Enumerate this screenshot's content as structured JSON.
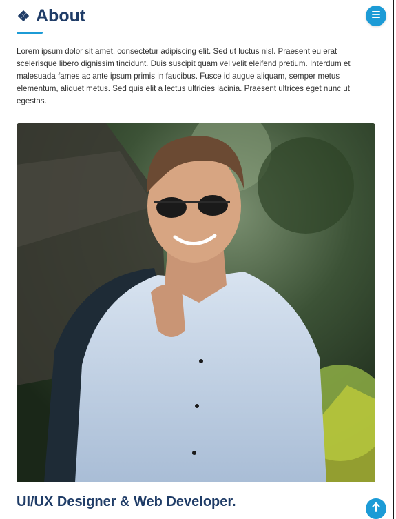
{
  "header": {
    "title": "About",
    "title_icon": "diamond-icon",
    "menu_icon": "menu-icon"
  },
  "about": {
    "text": "Lorem ipsum dolor sit amet, consectetur adipiscing elit. Sed ut luctus nisl. Praesent eu erat scelerisque libero dignissim tincidunt. Duis suscipit quam vel velit eleifend pretium. Interdum et malesuada fames ac ante ipsum primis in faucibus. Fusce id augue aliquam, semper metus elementum, aliquet metus. Sed quis elit a lectus ultricies lacinia. Praesent ultrices eget nunc ut egestas."
  },
  "photo": {
    "subject": "profile-photo"
  },
  "role": "UI/UX Designer & Web Developer.",
  "scroll_top_icon": "arrow-up-icon",
  "colors": {
    "accent": "#1c9bd6",
    "heading": "#1f3c67",
    "text": "#333333"
  }
}
